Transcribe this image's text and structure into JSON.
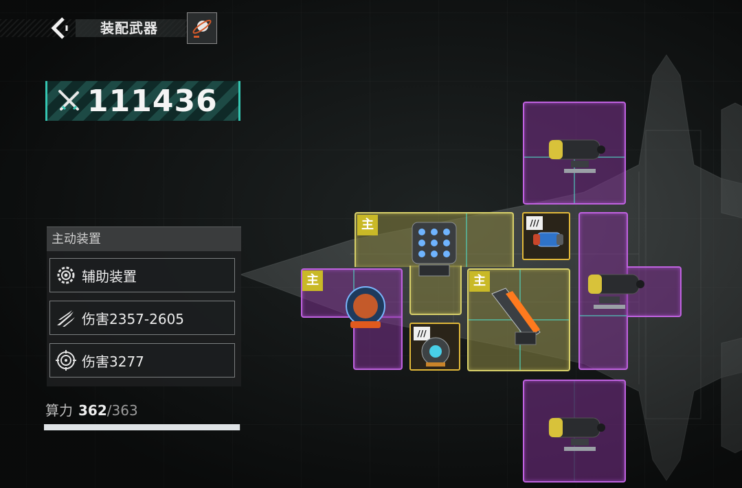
{
  "header": {
    "title": "装配武器"
  },
  "power_score": "111436",
  "active_panel": {
    "header": "主动装置",
    "rows": [
      {
        "icon": "gear-target-icon",
        "label": "辅助装置"
      },
      {
        "icon": "claw-slash-icon",
        "label": "伤害2357-2605"
      },
      {
        "icon": "reticle-icon",
        "label": "伤害3277"
      }
    ]
  },
  "compute": {
    "label": "算力",
    "current": "362",
    "max": "/363",
    "ratio": 0.997
  },
  "slots": {
    "main_tag": "主",
    "mini_tag": "///"
  },
  "colors": {
    "accent_teal": "#35c6b2",
    "slot_purple": "#c062e0",
    "slot_yellow": "#d8d06a",
    "main_tag": "#c9b927"
  }
}
